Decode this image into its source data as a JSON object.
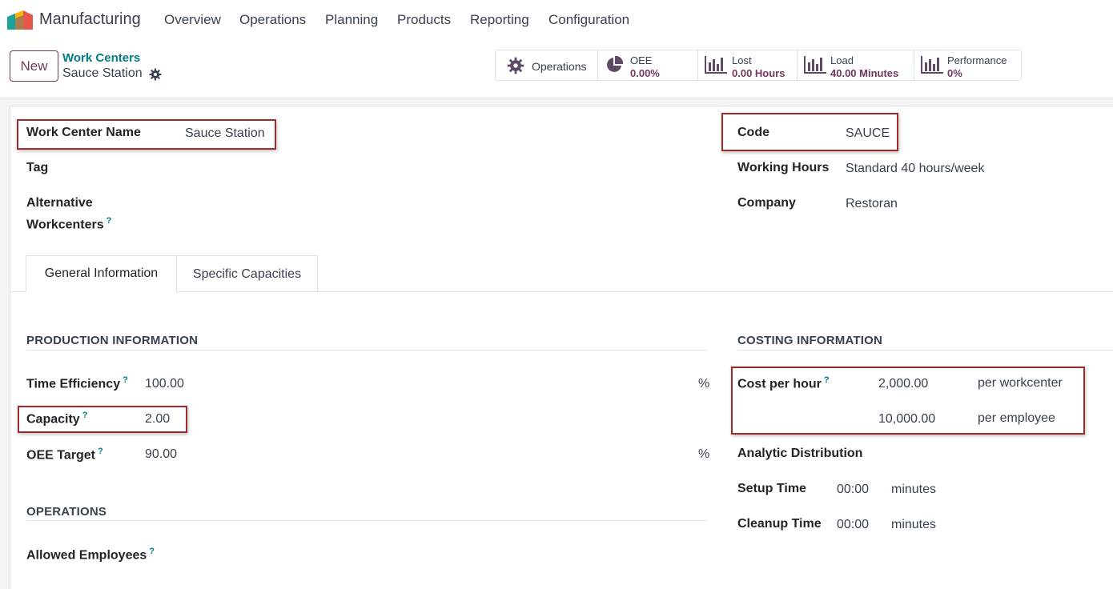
{
  "nav": {
    "app_name": "Manufacturing",
    "menu": [
      "Overview",
      "Operations",
      "Planning",
      "Products",
      "Reporting",
      "Configuration"
    ]
  },
  "control": {
    "new_label": "New",
    "breadcrumb_parent": "Work Centers",
    "breadcrumb_current": "Sauce Station"
  },
  "stats": {
    "operations_label": "Operations",
    "oee_label": "OEE",
    "oee_value": "0.00%",
    "lost_label": "Lost",
    "lost_value": "0.00 Hours",
    "load_label": "Load",
    "load_value": "40.00 Minutes",
    "performance_label": "Performance",
    "performance_value": "0%"
  },
  "form": {
    "name_label": "Work Center Name",
    "name_value": "Sauce Station",
    "tag_label": "Tag",
    "alt_label_1": "Alternative",
    "alt_label_2": "Workcenters",
    "code_label": "Code",
    "code_value": "SAUCE",
    "hours_label": "Working Hours",
    "hours_value": "Standard 40 hours/week",
    "company_label": "Company",
    "company_value": "Restoran",
    "help_mark": "?"
  },
  "tabs": [
    "General Information",
    "Specific Capacities"
  ],
  "production": {
    "title": "PRODUCTION INFORMATION",
    "efficiency_label": "Time Efficiency",
    "efficiency_value": "100.00",
    "percent": "%",
    "capacity_label": "Capacity",
    "capacity_value": "2.00",
    "oee_target_label": "OEE Target",
    "oee_target_value": "90.00"
  },
  "operations": {
    "title": "OPERATIONS",
    "employees_label": "Allowed Employees"
  },
  "costing": {
    "title": "COSTING INFORMATION",
    "cost_label": "Cost per hour",
    "cost_workcenter": "2,000.00",
    "per_workcenter": "per workcenter",
    "cost_employee": "10,000.00",
    "per_employee": "per employee",
    "analytic_label": "Analytic Distribution",
    "setup_label": "Setup Time",
    "setup_value": "00:00",
    "cleanup_label": "Cleanup Time",
    "cleanup_value": "00:00",
    "minutes": "minutes"
  },
  "colors": {
    "brand": "#71395e",
    "link": "#017e84",
    "highlight": "#a02a2a"
  }
}
